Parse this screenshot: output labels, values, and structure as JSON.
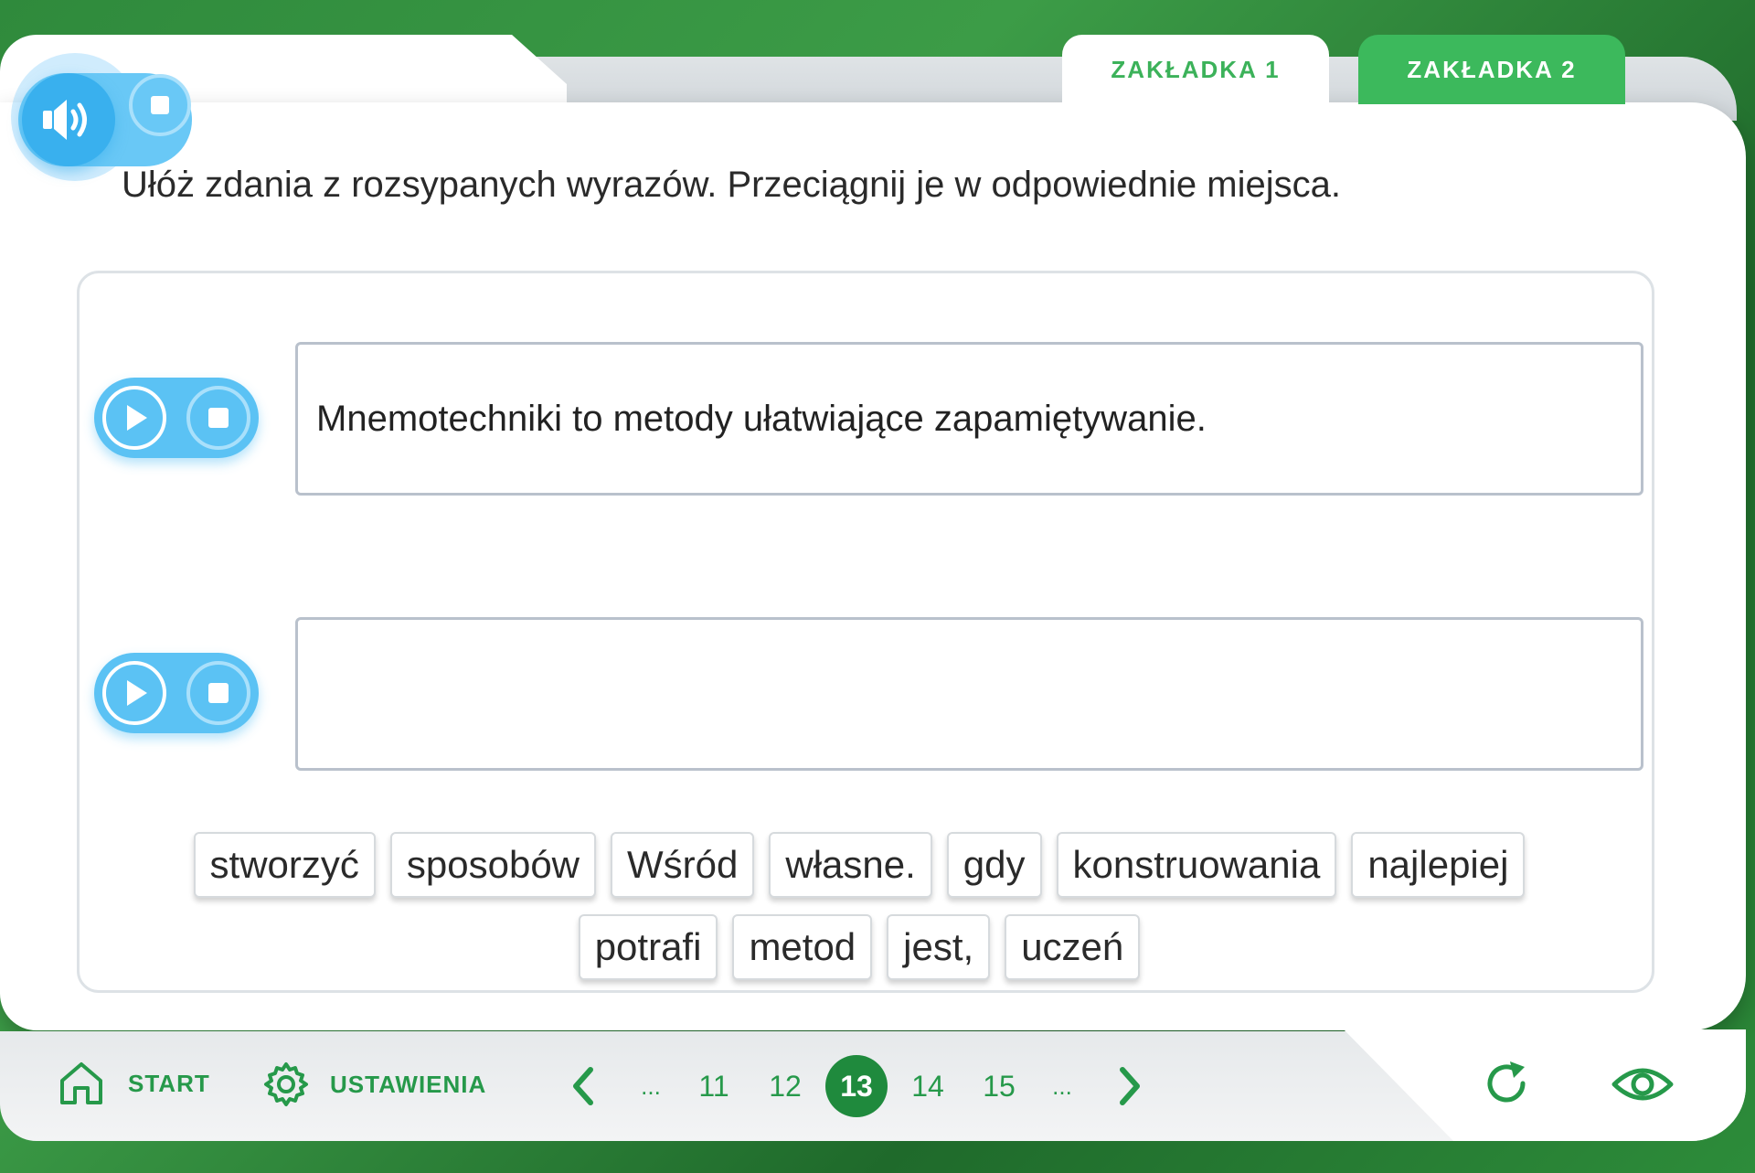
{
  "tabs": [
    {
      "label": "ZAKŁADKA 1",
      "active": false
    },
    {
      "label": "ZAKŁADKA 2",
      "active": true
    }
  ],
  "instruction": "Ułóż zdania z rozsypanych wyrazów. Przeciągnij je w odpowiednie miejsca.",
  "sentences": [
    {
      "text": "Mnemotechniki to metody ułatwiające zapamiętywanie."
    },
    {
      "text": ""
    }
  ],
  "word_bank": [
    "stworzyć",
    "sposobów",
    "Wśród",
    "własne.",
    "gdy",
    "konstruowania",
    "najlepiej",
    "potrafi",
    "metod",
    "jest,",
    "uczeń"
  ],
  "footer": {
    "start_label": "START",
    "settings_label": "USTAWIENIA",
    "ellipsis_left": "...",
    "pages": [
      "11",
      "12",
      "13",
      "14",
      "15"
    ],
    "current_page": "13",
    "ellipsis_right": "..."
  },
  "colors": {
    "green_primary": "#26994a",
    "green_tab": "#3cb95c",
    "audio_blue": "#5bc2f4",
    "box_border": "#b9c1cc"
  },
  "icons": {
    "speaker": "speaker-icon",
    "home": "home-icon",
    "settings": "gear-icon",
    "reload": "reload-icon",
    "eye": "eye-icon"
  }
}
